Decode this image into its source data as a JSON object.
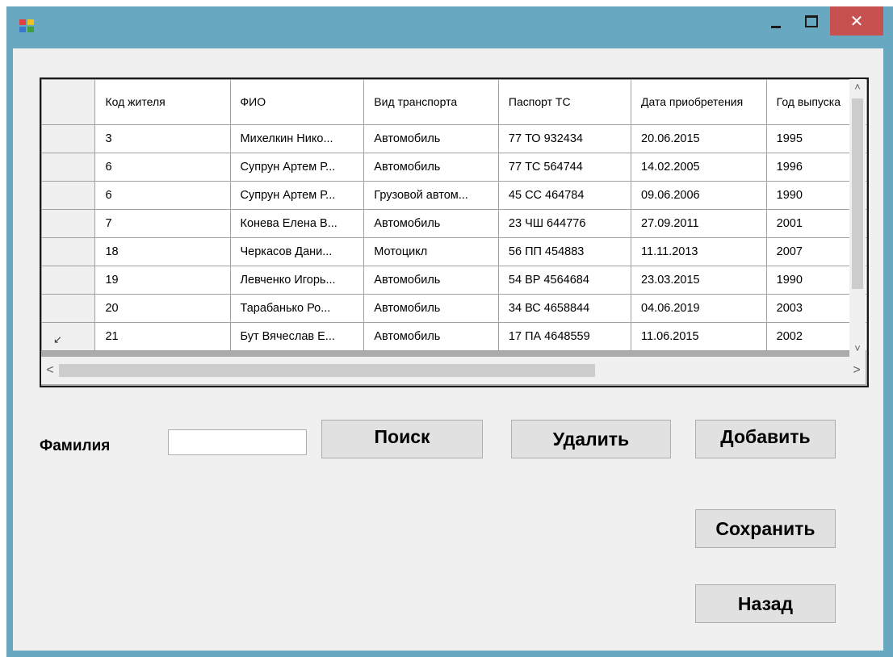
{
  "window": {
    "title": "",
    "controls": {
      "minimize": "minimize-icon",
      "maximize": "maximize-icon",
      "close": "✕"
    },
    "accent_color": "#68a8c0",
    "close_color": "#c75050"
  },
  "grid": {
    "columns": [
      "Код жителя",
      "ФИО",
      "Вид транспорта",
      "Паспорт ТС",
      "Дата приобретения",
      "Год выпуска"
    ],
    "rows": [
      [
        "3",
        "Михелкин Нико...",
        "Автомобиль",
        "77 ТО 932434",
        "20.06.2015",
        "1995"
      ],
      [
        "6",
        "Супрун Артем Р...",
        "Автомобиль",
        "77 ТС 564744",
        "14.02.2005",
        "1996"
      ],
      [
        "6",
        "Супрун Артем Р...",
        "Грузовой автом...",
        "45 СС 464784",
        "09.06.2006",
        "1990"
      ],
      [
        "7",
        "Конева Елена В...",
        "Автомобиль",
        "23 ЧШ 644776",
        "27.09.2011",
        "2001"
      ],
      [
        "18",
        "Черкасов Дани...",
        "Мотоцикл",
        "56 ПП 454883",
        "11.11.2013",
        "2007"
      ],
      [
        "19",
        "Левченко Игорь...",
        "Автомобиль",
        "54 ВР 4564684",
        "23.03.2015",
        "1990"
      ],
      [
        "20",
        "Тарабанько Ро...",
        "Автомобиль",
        "34 ВС 4658844",
        "04.06.2019",
        "2003"
      ],
      [
        "21",
        "Бут Вячеслав Е...",
        "Автомобиль",
        "17 ПА 4648559",
        "11.06.2015",
        "2002"
      ]
    ],
    "current_row_marker": "↙"
  },
  "search": {
    "label": "Фамилия",
    "value": ""
  },
  "buttons": {
    "search": "Поиск",
    "delete": "Удалить",
    "add": "Добавить",
    "save": "Сохранить",
    "back": "Назад"
  },
  "scrollbars": {
    "up": "˄",
    "down": "˅",
    "left": "<",
    "right": ">"
  }
}
